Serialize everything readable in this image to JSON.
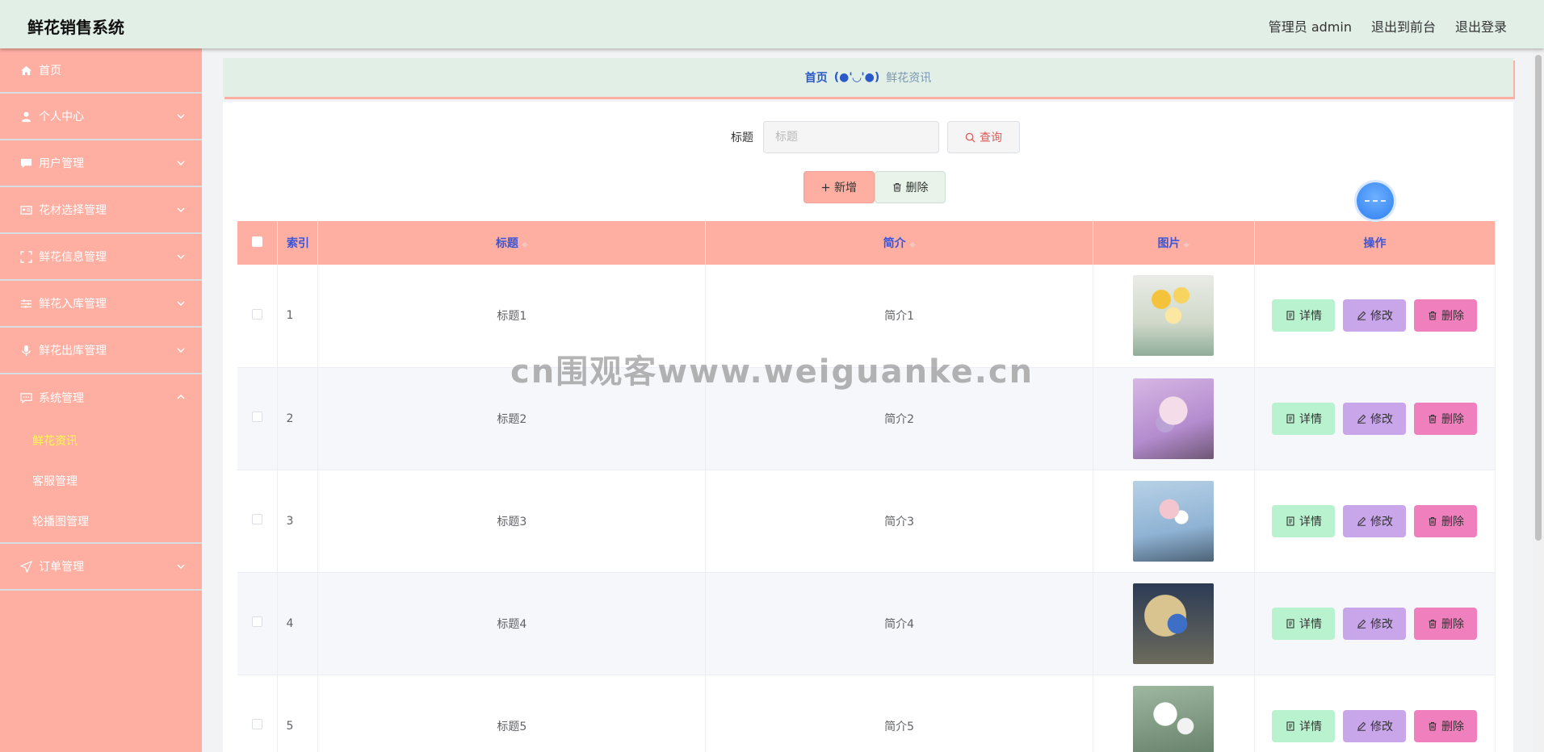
{
  "header": {
    "title": "鲜花销售系统",
    "admin_label": "管理员 admin",
    "front_link": "退出到前台",
    "logout_link": "退出登录"
  },
  "sidebar": {
    "items": [
      {
        "label": "首页",
        "icon": "home-icon"
      },
      {
        "label": "个人中心",
        "icon": "user-icon"
      },
      {
        "label": "用户管理",
        "icon": "chat-icon"
      },
      {
        "label": "花材选择管理",
        "icon": "id-card-icon"
      },
      {
        "label": "鲜花信息管理",
        "icon": "scan-icon"
      },
      {
        "label": "鲜花入库管理",
        "icon": "sliders-icon"
      },
      {
        "label": "鲜花出库管理",
        "icon": "microphone-icon"
      },
      {
        "label": "系统管理",
        "icon": "message-icon"
      },
      {
        "label": "订单管理",
        "icon": "send-icon"
      }
    ],
    "system_sub": [
      "鲜花资讯",
      "客服管理",
      "轮播图管理"
    ]
  },
  "breadcrumb": {
    "home": "首页",
    "separator": "(●'◡'●)",
    "current": "鲜花资讯"
  },
  "search": {
    "label": "标题",
    "placeholder": "标题",
    "query_button": "查询"
  },
  "actions": {
    "add": "新增",
    "delete": "删除"
  },
  "table": {
    "headers": {
      "index": "索引",
      "title": "标题",
      "intro": "简介",
      "image": "图片",
      "ops": "操作"
    },
    "rows": [
      {
        "index": "1",
        "title": "标题1",
        "intro": "简介1"
      },
      {
        "index": "2",
        "title": "标题2",
        "intro": "简介2"
      },
      {
        "index": "3",
        "title": "标题3",
        "intro": "简介3"
      },
      {
        "index": "4",
        "title": "标题4",
        "intro": "简介4"
      },
      {
        "index": "5",
        "title": "标题5",
        "intro": "简介5"
      }
    ],
    "op_labels": {
      "detail": "详情",
      "edit": "修改",
      "delete": "删除"
    }
  },
  "watermark": "cn围观客www.weiguanke.cn",
  "colors": {
    "header_bg": "#e2efe6",
    "sidebar_bg": "#ffaea2",
    "active_sub": "#ffff44",
    "detail_btn": "#b8f2cf",
    "edit_btn": "#c9a5ea",
    "delete_btn": "#f07fbd"
  }
}
